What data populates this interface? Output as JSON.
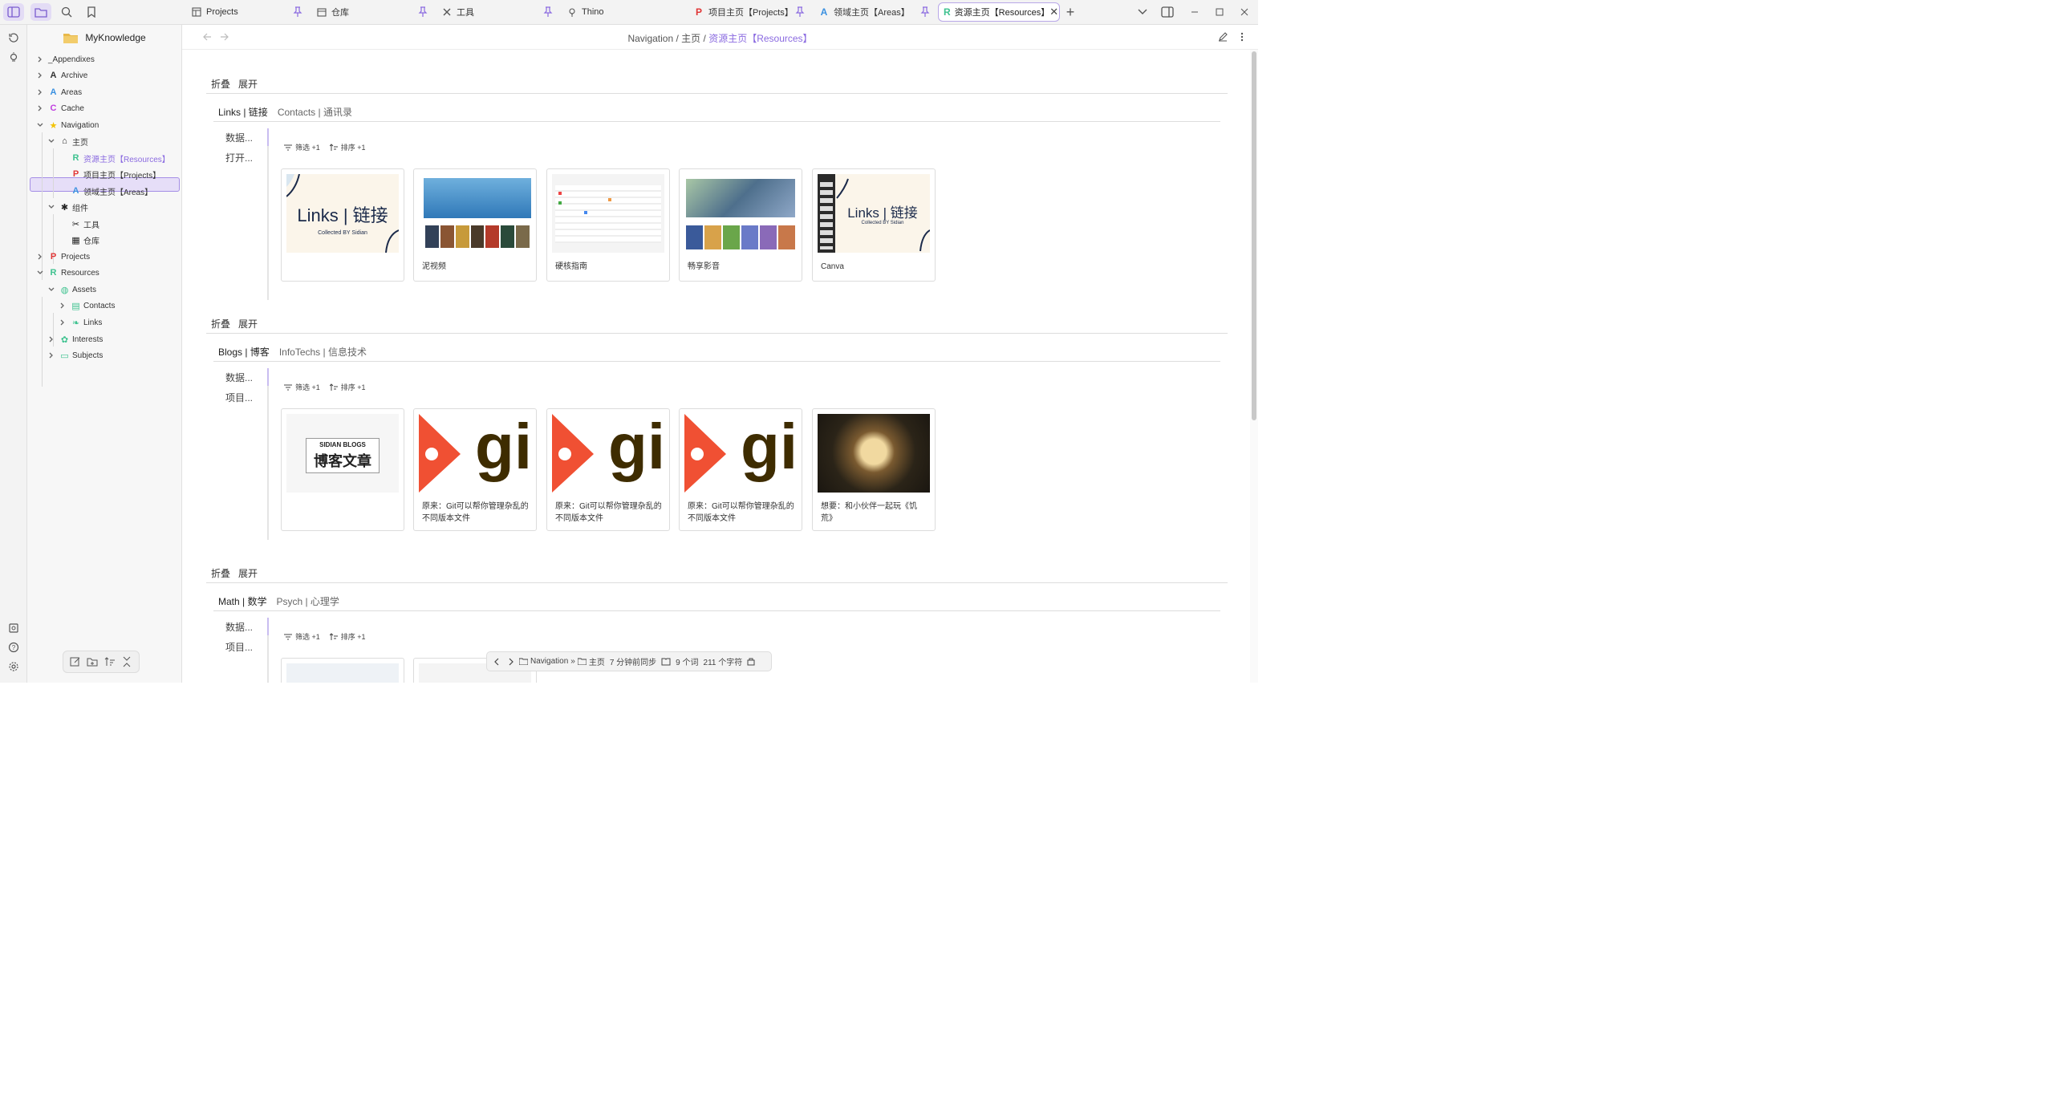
{
  "tabs": [
    {
      "label": "Projects",
      "icon": "layout-icon"
    },
    {
      "label": "仓库",
      "icon": "calendar-icon"
    },
    {
      "label": "工具",
      "icon": "tools-icon"
    },
    {
      "label": "Thino",
      "icon": "bulb-icon"
    },
    {
      "label": "项目主页【Projects】",
      "icon": "P",
      "color": "#e03535"
    },
    {
      "label": "领域主页【Areas】",
      "icon": "A",
      "color": "#3a90e0"
    },
    {
      "label": "资源主页【Resources】",
      "icon": "R",
      "color": "#3ec28f"
    }
  ],
  "vault_name": "MyKnowledge",
  "breadcrumb": {
    "part1": "Navigation",
    "sep1": " / ",
    "part2": "主页",
    "sep2": " / ",
    "current": "资源主页【Resources】"
  },
  "tree": [
    {
      "label": "_Appendixes"
    },
    {
      "label": "Archive",
      "icon": "A",
      "color": "#333"
    },
    {
      "label": "Areas",
      "icon": "A",
      "color": "#3a90e0"
    },
    {
      "label": "Cache",
      "icon": "C",
      "color": "#c03ee0"
    },
    {
      "label": "Navigation",
      "icon": "★",
      "color": "#f2c200"
    },
    {
      "label": "主页",
      "icon": "⌂",
      "color": "#222"
    },
    {
      "label": "资源主页【Resources】",
      "icon": "R",
      "color": "#3ec28f"
    },
    {
      "label": "项目主页【Projects】",
      "icon": "P",
      "color": "#e03535"
    },
    {
      "label": "领域主页【Areas】",
      "icon": "A",
      "color": "#3a90e0"
    },
    {
      "label": "组件",
      "icon": "✱",
      "color": "#222"
    },
    {
      "label": "工具",
      "icon": "✂",
      "color": "#222"
    },
    {
      "label": "仓库",
      "icon": "▦",
      "color": "#222"
    },
    {
      "label": "Projects",
      "icon": "P",
      "color": "#e03535"
    },
    {
      "label": "Resources",
      "icon": "R",
      "color": "#3ec28f"
    },
    {
      "label": "Assets",
      "icon": "◍",
      "color": "#3ec28f"
    },
    {
      "label": "Contacts",
      "icon": "▤",
      "color": "#3ec28f"
    },
    {
      "label": "Links",
      "icon": "❧",
      "color": "#3ec28f"
    },
    {
      "label": "Interests",
      "icon": "✿",
      "color": "#3ec28f"
    },
    {
      "label": "Subjects",
      "icon": "▭",
      "color": "#3ec28f"
    }
  ],
  "sections": [
    {
      "collapse": "折叠",
      "expand": "展开",
      "tab1": "Links | 链接",
      "tab2": "Contacts | 通讯录",
      "left1": "数据...",
      "left2": "打开...",
      "filter": "筛选 +1",
      "sort": "排序 +1",
      "cards": [
        {
          "caption": "",
          "img_text1": "Links | 链接",
          "img_text2": "Collected BY Sidian"
        },
        {
          "caption": "泥视频"
        },
        {
          "caption": "硬核指南"
        },
        {
          "caption": "畅享影音"
        },
        {
          "caption": "Canva",
          "img_text1": "Links | 链接",
          "img_text2": "Collected BY Sidian"
        }
      ]
    },
    {
      "collapse": "折叠",
      "expand": "展开",
      "tab1": "Blogs | 博客",
      "tab2": "InfoTechs | 信息技术",
      "left1": "数据...",
      "left2": "项目...",
      "filter": "筛选 +1",
      "sort": "排序 +1",
      "cards": [
        {
          "caption": "",
          "img_text1": "SIDIAN BLOGS",
          "img_text2": "博客文章"
        },
        {
          "caption": "原来：Git可以帮你管理杂乱的不同版本文件",
          "img_text1": "gi"
        },
        {
          "caption": "原来：Git可以帮你管理杂乱的不同版本文件",
          "img_text1": "gi"
        },
        {
          "caption": "原来：Git可以帮你管理杂乱的不同版本文件",
          "img_text1": "gi"
        },
        {
          "caption": "想要：和小伙伴一起玩《饥荒》"
        }
      ]
    },
    {
      "collapse": "折叠",
      "expand": "展开",
      "tab1": "Math | 数学",
      "tab2": "Psych | 心理学",
      "left1": "数据...",
      "left2": "项目...",
      "filter": "筛选 +1",
      "sort": "排序 +1"
    }
  ],
  "status": {
    "crumb1": "Navigation",
    "crumb2": "主页",
    "synced": "7 分钟前同步",
    "words": "9 个词",
    "chars": "211 个字符"
  },
  "accent": "#8a6ae0"
}
